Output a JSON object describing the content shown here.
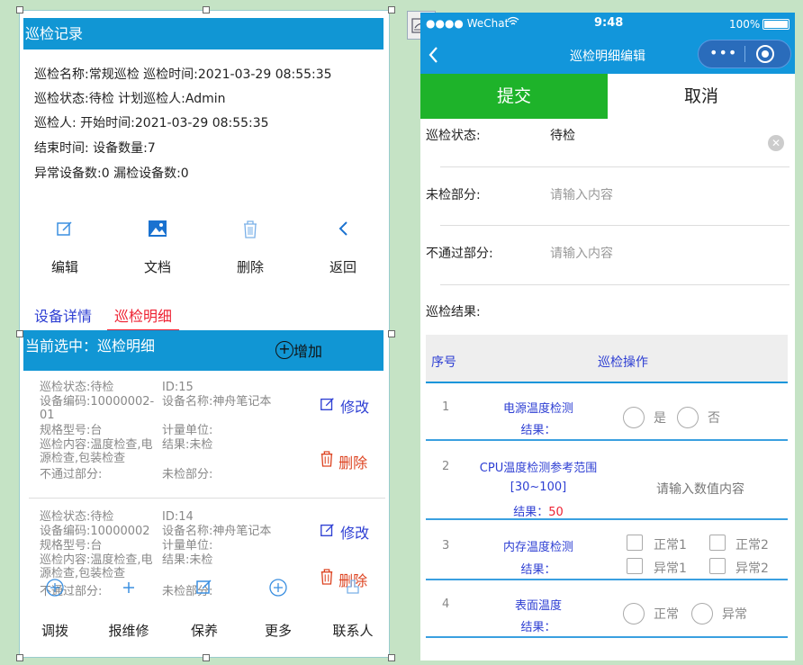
{
  "left": {
    "title": "巡检记录",
    "info": [
      "巡检名称:常规巡检 巡检时间:2021-03-29 08:55:35",
      "巡检状态:待检 计划巡检人:Admin",
      "巡检人: 开始时间:2021-03-29 08:55:35",
      "结束时间: 设备数量:7",
      "异常设备数:0 漏检设备数:0"
    ],
    "actions": [
      {
        "icon": "edit-icon",
        "label": "编辑"
      },
      {
        "icon": "image-icon",
        "label": "文档"
      },
      {
        "icon": "trash-icon",
        "label": "删除"
      },
      {
        "icon": "back-icon",
        "label": "返回"
      }
    ],
    "tabs": [
      "设备详情",
      "巡检明细"
    ],
    "current_label": "当前选中：巡检明细",
    "add_label": "增加",
    "records": [
      {
        "lines": [
          [
            "巡检状态:待检",
            "ID:15"
          ],
          [
            "设备编码:10000002-01",
            "设备名称:神舟笔记本"
          ],
          [
            "规格型号:台",
            "计量单位:"
          ],
          [
            "巡检内容:温度检查,电源检查,包装检查",
            "结果:未检"
          ],
          [
            "不通过部分:",
            "未检部分:"
          ]
        ],
        "edit_label": "修改",
        "delete_label": "删除"
      },
      {
        "lines": [
          [
            "巡检状态:待检",
            "ID:14"
          ],
          [
            "设备编码:10000002",
            "设备名称:神舟笔记本"
          ],
          [
            "规格型号:台",
            "计量单位:"
          ],
          [
            "巡检内容:温度检查,电源检查,包装检查",
            "结果:未检"
          ],
          [
            "不通过部分:",
            "未检部分:"
          ]
        ],
        "edit_label": "修改",
        "delete_label": "删除"
      }
    ],
    "bottom_nav": [
      {
        "icon": "plus-circle-icon",
        "label": "调拨"
      },
      {
        "icon": "plus-icon",
        "label": "报维修"
      },
      {
        "icon": "edit-icon",
        "label": "保养"
      },
      {
        "icon": "plus-circle-icon",
        "label": "更多"
      },
      {
        "icon": "contact-icon",
        "label": "联系人"
      }
    ]
  },
  "phone": {
    "status": {
      "carrier": "●●●● WeChat",
      "time": "9:48",
      "battery": "100%"
    },
    "nav_title": "巡检明细编辑",
    "submit_label": "提交",
    "cancel_label": "取消",
    "fields": [
      {
        "label": "巡检状态:",
        "value": "待检",
        "placeholder": ""
      },
      {
        "label": "未检部分:",
        "value": "",
        "placeholder": "请输入内容"
      },
      {
        "label": "不通过部分:",
        "value": "",
        "placeholder": "请输入内容"
      },
      {
        "label": "巡检结果:",
        "value": "",
        "placeholder": ""
      }
    ],
    "table_headers": [
      "序号",
      "巡检操作"
    ],
    "rows": [
      {
        "no": "1",
        "name": "电源温度检测",
        "result_label": "结果：",
        "result_value": "",
        "options": [
          "是",
          "否"
        ]
      },
      {
        "no": "2",
        "name": "CPU温度检测参考范围",
        "range": "[30~100]",
        "result_label": "结果：",
        "result_value": "50",
        "input_placeholder": "请输入数值内容"
      },
      {
        "no": "3",
        "name": "内存温度检测",
        "result_label": "结果：",
        "result_value": "",
        "options": [
          "正常1",
          "正常2",
          "异常1",
          "异常2"
        ]
      },
      {
        "no": "4",
        "name": "表面温度",
        "result_label": "结果：",
        "result_value": "",
        "options": [
          "正常",
          "异常"
        ]
      }
    ]
  }
}
